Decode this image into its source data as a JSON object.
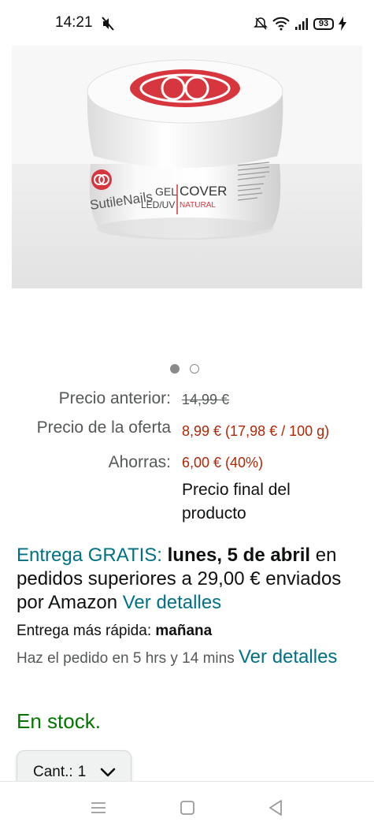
{
  "status_bar": {
    "time": "14:21",
    "battery": "93"
  },
  "product_image": {
    "brand_mark": "SutileNails",
    "label_gel": "GEL",
    "label_cover": "COVER",
    "label_leduv": "LED/UV",
    "label_natural": "NATURAL"
  },
  "carousel": {
    "current_page": 1,
    "total_pages": 2
  },
  "prices": {
    "previous_label": "Precio anterior:",
    "previous_value": "14,99 €",
    "offer_label": "Precio de la oferta",
    "offer_value": "8,99 € (17,98 € / 100 g)",
    "savings_label": "Ahorras:",
    "savings_value": "6,00 € (40%)",
    "final_note": "Precio final del producto"
  },
  "delivery": {
    "free_label": "Entrega GRATIS:",
    "date": "lunes, 5 de abril",
    "condition": "en pedidos superiores a 29,00 € enviados por Amazon",
    "details_link": "Ver detalles",
    "fastest_label": "Entrega más rápida:",
    "fastest_day": "mañana",
    "order_within": "Haz el pedido en 5 hrs y 14 mins",
    "details_link_2": "Ver detalles"
  },
  "stock": {
    "status": "En stock."
  },
  "quantity": {
    "label": "Cant.:",
    "value": "1"
  },
  "colors": {
    "price_red": "#b12704",
    "link_teal": "#007185",
    "stock_green": "#007600",
    "brand_red": "#d8363e"
  }
}
